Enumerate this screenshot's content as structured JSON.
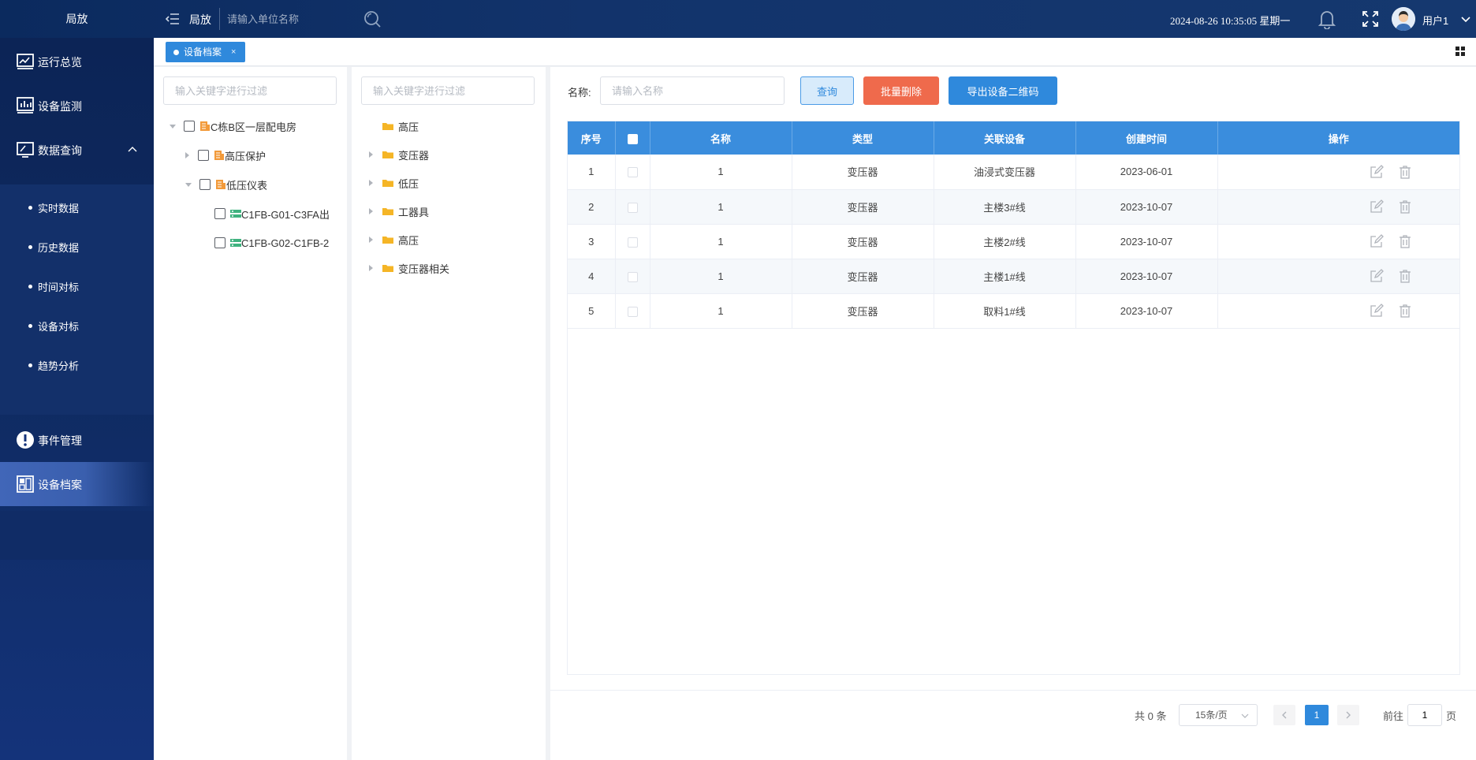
{
  "header": {
    "brand": "局放",
    "title": "局放",
    "unit_search_placeholder": "请输入单位名称",
    "datetime": "2024-08-26 10:35:05 星期一",
    "username": "用户1"
  },
  "sidebar": {
    "items": [
      {
        "label": "运行总览",
        "icon": "monitor-chart-icon"
      },
      {
        "label": "设备监测",
        "icon": "bar-chart-icon"
      },
      {
        "label": "数据查询",
        "icon": "screen-search-icon",
        "expanded": true
      },
      {
        "label": "事件管理",
        "icon": "alert-icon"
      },
      {
        "label": "设备档案",
        "icon": "archive-icon",
        "active": true
      }
    ],
    "sub_items": [
      {
        "label": "实时数据"
      },
      {
        "label": "历史数据"
      },
      {
        "label": "时间对标"
      },
      {
        "label": "设备对标"
      },
      {
        "label": "趋势分析"
      }
    ]
  },
  "tabs": [
    {
      "label": "设备档案",
      "close": "×",
      "active": true
    }
  ],
  "tree1": {
    "filter_placeholder": "输入关键字进行过滤",
    "nodes": [
      {
        "label": "C栋B区一层配电房",
        "type": "building",
        "expanded": true
      },
      {
        "label": "高压保护",
        "type": "building",
        "expanded": false
      },
      {
        "label": "低压仪表",
        "type": "building",
        "expanded": true
      },
      {
        "label": "C1FB-G01-C3FA出",
        "type": "device"
      },
      {
        "label": "C1FB-G02-C1FB-2",
        "type": "device"
      }
    ]
  },
  "tree2": {
    "filter_placeholder": "输入关键字进行过滤",
    "nodes": [
      {
        "label": "高压",
        "has_children": false
      },
      {
        "label": "变压器",
        "has_children": true
      },
      {
        "label": "低压",
        "has_children": true
      },
      {
        "label": "工器具",
        "has_children": true
      },
      {
        "label": "高压",
        "has_children": true
      },
      {
        "label": "变压器相关",
        "has_children": true
      }
    ]
  },
  "toolbar": {
    "name_label": "名称:",
    "name_placeholder": "请输入名称",
    "query_label": "查询",
    "batch_delete_label": "批量删除",
    "export_qr_label": "导出设备二维码"
  },
  "table": {
    "columns": [
      "序号",
      "",
      "名称",
      "类型",
      "关联设备",
      "创建时间",
      "操作"
    ],
    "rows": [
      {
        "index": "1",
        "name": "1",
        "type": "变压器",
        "device": "油浸式变压器",
        "created": "2023-06-01"
      },
      {
        "index": "2",
        "name": "1",
        "type": "变压器",
        "device": "主楼3#线",
        "created": "2023-10-07"
      },
      {
        "index": "3",
        "name": "1",
        "type": "变压器",
        "device": "主楼2#线",
        "created": "2023-10-07"
      },
      {
        "index": "4",
        "name": "1",
        "type": "变压器",
        "device": "主楼1#线",
        "created": "2023-10-07"
      },
      {
        "index": "5",
        "name": "1",
        "type": "变压器",
        "device": "取料1#线",
        "created": "2023-10-07"
      }
    ]
  },
  "pagination": {
    "total": "共 0 条",
    "page_size": "15条/页",
    "current_page": "1",
    "goto_label": "前往",
    "goto_value": "1",
    "goto_suffix": "页"
  },
  "colors": {
    "header_bg": "#0b2a5e",
    "sidebar_bg": "#0c2456",
    "accent": "#2f89dc",
    "table_header": "#3a8ddd",
    "danger": "#ef6a4c",
    "folder": "#f5b526",
    "device": "#3fb27f"
  }
}
